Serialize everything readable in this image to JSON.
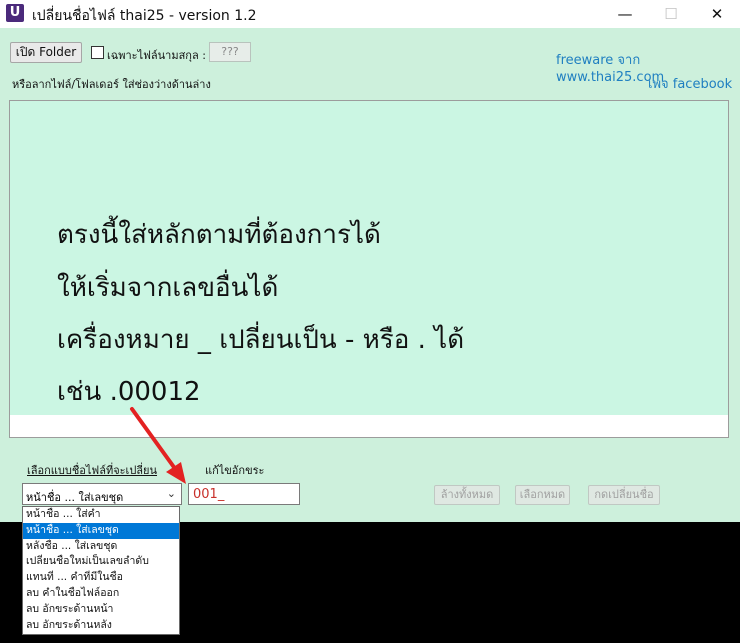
{
  "window": {
    "app_icon": "U",
    "title": "เปลี่ยนชื่อไฟล์ thai25 - version 1.2",
    "controls": {
      "minimize": "—",
      "maximize": "☐",
      "close": "✕"
    }
  },
  "toolbar": {
    "open_folder": "เปิด Folder",
    "filter_label": "เฉพาะไฟล์นามสกุล :",
    "filter_value": "???",
    "hint": "หรือลากไฟล์/โฟลเดอร์ ใส่ช่องว่างด้านล่าง",
    "freeware_link": "freeware จาก www.thai25.com",
    "facebook_link": "เพจ facebook"
  },
  "drop_area": {
    "lines": [
      "ตรงนี้ใส่หลักตามที่ต้องการได้",
      "ให้เริ่มจากเลขอื่นได้",
      "เครื่องหมาย _ เปลี่ยนเป็น - หรือ . ได้",
      "เช่น .00012"
    ]
  },
  "controls": {
    "mode_label": "เลือกแบบชื่อไฟล์ที่จะเปลี่ยน",
    "edit_label": "แก้ไขอักขระ",
    "selected_mode": "หน้าชื่อ ... ใส่เลขชุด",
    "input_value": "001_",
    "clear_all": "ล้างทั้งหมด",
    "select_all": "เลือกหมด",
    "rename": "กดเปลี่ยนชื่อ"
  },
  "dropdown_options": [
    "หน้าชื่อ ... ใส่คำ",
    "หน้าชื่อ ... ใส่เลขชุด",
    "หลังชื่อ ... ใส่เลขชุด",
    "เปลี่ยนชื่อใหม่เป็นเลขลำดับ",
    "แทนที่ ... คำที่มีในชื่อ",
    "ลบ คำในชื่อไฟล์ออก",
    "ลบ อักขระด้านหน้า",
    "ลบ อักขระด้านหลัง"
  ],
  "dropdown_selected_index": 1,
  "colors": {
    "background": "#cdf0dc",
    "link": "#1f7fc1",
    "selection": "#0078d7",
    "arrow": "#e32222"
  }
}
